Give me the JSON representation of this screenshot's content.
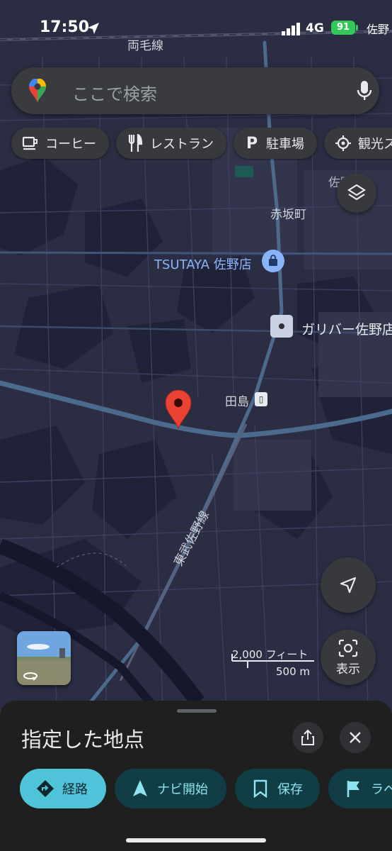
{
  "status_bar": {
    "time": "17:50",
    "network": "4G",
    "battery": "91",
    "area_label": "佐野"
  },
  "search": {
    "placeholder": "ここで検索"
  },
  "chips": [
    {
      "label": "コーヒー",
      "icon": "coffee-icon"
    },
    {
      "label": "レストラン",
      "icon": "restaurant-icon"
    },
    {
      "label": "駐車場",
      "icon": "parking-icon"
    },
    {
      "label": "観光ス",
      "icon": "tourism-icon"
    }
  ],
  "map_labels": {
    "railway_top": "両毛線",
    "district_akasaka": "赤坂町",
    "poi_tsutaya": "TSUTAYA 佐野店",
    "poi_gulliver": "ガリバー佐野店",
    "station_tajima": "田島",
    "railway_tobu": "東武佐野線",
    "area_sano": "佐野市"
  },
  "scale": {
    "feet": "2,000 フィート",
    "meters": "500 m"
  },
  "lens_button": {
    "label": "表示"
  },
  "bottom_sheet": {
    "title": "指定した地点",
    "actions": [
      {
        "label": "経路",
        "icon": "directions-icon"
      },
      {
        "label": "ナビ開始",
        "icon": "navigation-icon"
      },
      {
        "label": "保存",
        "icon": "bookmark-icon"
      },
      {
        "label": "ラベ",
        "icon": "label-flag-icon"
      }
    ]
  },
  "colors": {
    "map_background": "#2b2d43",
    "road_major": "#4b6a8c",
    "pin_red": "#ea4335",
    "primary_action": "#4fc3d8",
    "secondary_action": "#113d45"
  }
}
